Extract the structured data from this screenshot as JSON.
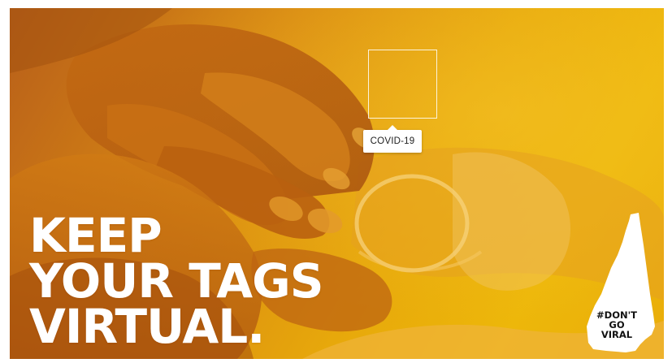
{
  "photo_tag": {
    "label": "COVID-19"
  },
  "headline": {
    "line1": "KEEP",
    "line2": "YOUR TAGS",
    "line3": "VIRTUAL."
  },
  "badge": {
    "line1": "#DON'T",
    "line2": "GO",
    "line3": "VIRAL"
  },
  "colors": {
    "overlay_warm": "#d98a12",
    "overlay_light": "#edb70a",
    "overlay_deep": "#b85f1a",
    "text": "#ffffff"
  },
  "icons": {
    "state_outline": "new-hampshire-silhouette-icon"
  }
}
